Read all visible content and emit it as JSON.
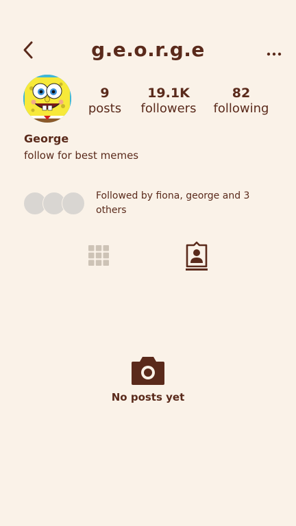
{
  "header": {
    "title": "g.e.o.r.g.e",
    "back_icon": "chevron-left-icon",
    "more_icon": "more-horizontal-icon"
  },
  "profile": {
    "avatar": "spongebob-avatar",
    "display_name": "George",
    "bio": "follow for best memes"
  },
  "stats": {
    "posts": {
      "value": "9",
      "label": "posts"
    },
    "followers": {
      "value": "19.1K",
      "label": "followers"
    },
    "following": {
      "value": "82",
      "label": "following"
    }
  },
  "followed_by": {
    "text": "Followed by fiona, george and 3 others"
  },
  "tabs": {
    "grid_icon": "grid-icon",
    "tagged_icon": "tagged-user-icon",
    "active": "tagged"
  },
  "empty_state": {
    "icon": "camera-icon",
    "text": "No posts yet"
  },
  "colors": {
    "background": "#faf2e8",
    "text": "#5a2a1b",
    "inactive_icon": "#cdc3b6"
  }
}
